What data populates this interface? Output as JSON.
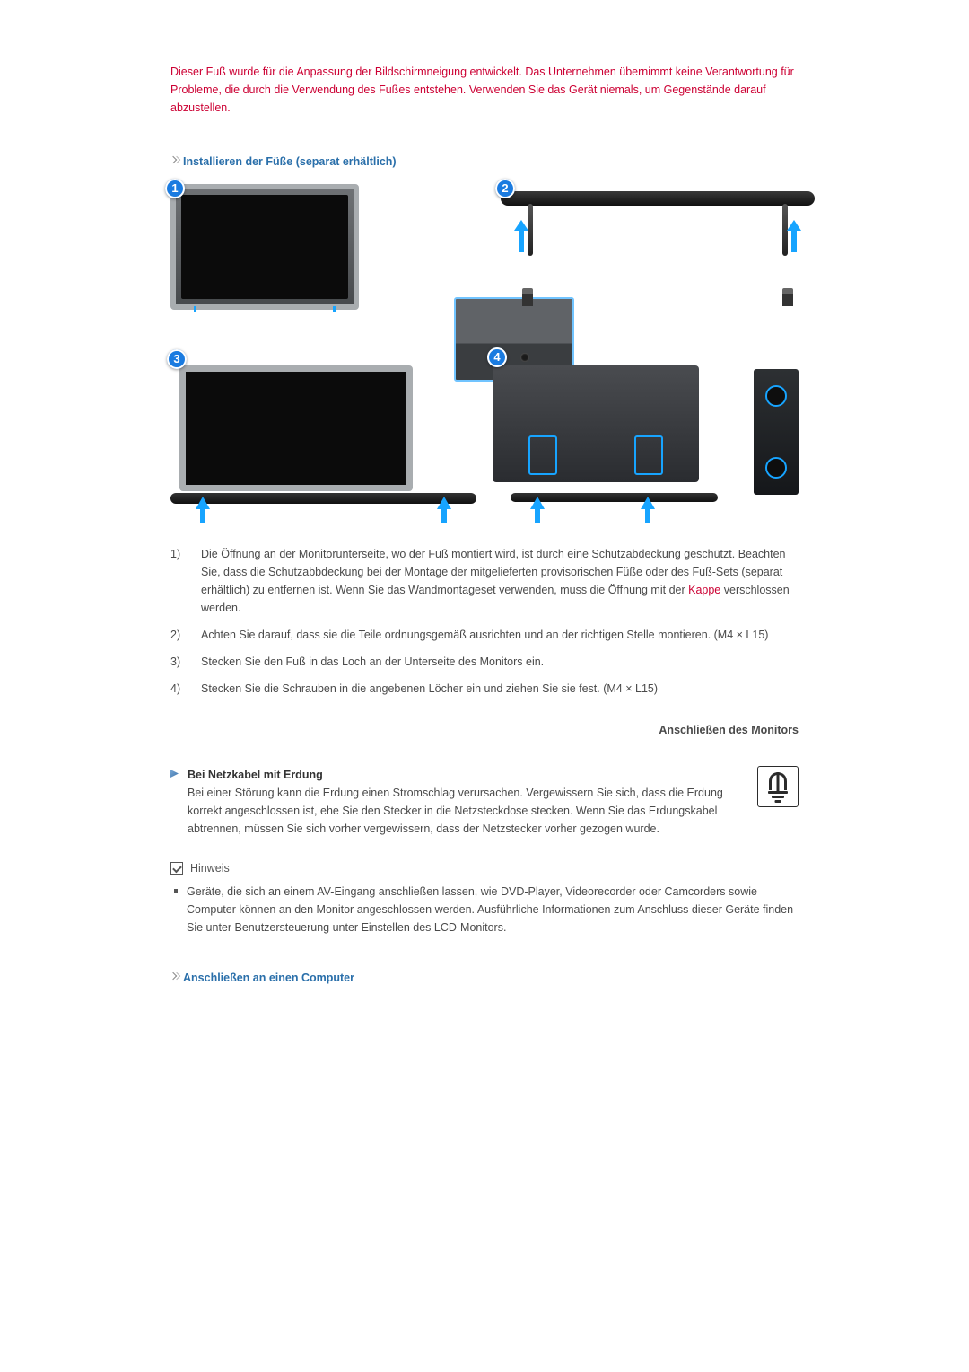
{
  "warning": "Dieser Fuß wurde für die Anpassung der Bildschirmneigung entwickelt. Das Unternehmen übernimmt keine Verantwortung für Probleme, die durch die Verwendung des Fußes entstehen. Verwenden Sie das Gerät niemals, um Gegenstände darauf abzustellen.",
  "section1": {
    "heading": "Installieren der Füße (separat erhältlich)",
    "badges": [
      "1",
      "2",
      "3",
      "4"
    ],
    "steps": [
      {
        "num": "1)",
        "text_a": "Die Öffnung an der Monitorunterseite, wo der Fuß montiert wird, ist durch eine Schutzabdeckung geschützt. Beachten Sie, dass die Schutzabbdeckung bei der Montage der mitgelieferten provisorischen Füße oder des Fuß-Sets (separat erhältlich) zu entfernen ist. Wenn Sie das Wandmontageset verwenden, muss die Öffnung mit der ",
        "link": "Kappe",
        "text_b": " verschlossen werden."
      },
      {
        "num": "2)",
        "text": "Achten Sie darauf, dass sie die Teile ordnungsgemäß ausrichten und an der richtigen Stelle montieren. (M4 × L15)"
      },
      {
        "num": "3)",
        "text": "Stecken Sie den Fuß in das Loch an der Unterseite des Monitors ein."
      },
      {
        "num": "4)",
        "text": "Stecken Sie die Schrauben in die angebenen Löcher ein und ziehen Sie sie fest. (M4 × L15)"
      }
    ]
  },
  "right_header": "Anschließen des Monitors",
  "grounding": {
    "title": "Bei Netzkabel mit Erdung",
    "text": "Bei einer Störung kann die Erdung einen Stromschlag verursachen. Vergewissern Sie sich, dass die Erdung korrekt angeschlossen ist, ehe Sie den Stecker in die Netzsteckdose stecken. Wenn Sie das Erdungskabel abtrennen, müssen Sie sich vorher vergewissern, dass der Netzstecker vorher gezogen wurde."
  },
  "note": {
    "label": "Hinweis",
    "bullet": "Geräte, die sich an einem AV-Eingang anschließen lassen, wie DVD-Player, Videorecorder oder Camcorders sowie Computer können an den Monitor angeschlossen werden. Ausführliche Informationen zum Anschluss dieser Geräte finden Sie unter Benutzersteuerung unter Einstellen des LCD-Monitors."
  },
  "section2": {
    "heading": "Anschließen an einen Computer"
  }
}
